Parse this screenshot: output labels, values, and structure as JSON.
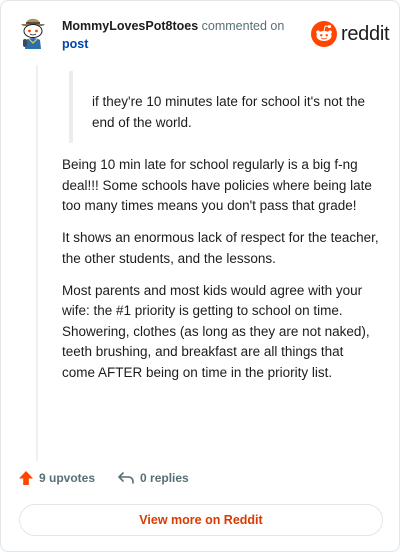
{
  "header": {
    "author": "MommyLovesPot8toes",
    "verb": "commented on",
    "target": "post"
  },
  "logo": {
    "word": "reddit",
    "icon": "reddit-snoo-icon",
    "color": "#ff4500"
  },
  "quote": {
    "text": "if they're 10 minutes late for school it's not the end of the world."
  },
  "comment": {
    "paragraphs": [
      "Being 10 min late for school regularly is a big f-ng deal!!! Some schools have policies where being late too many times means you don't pass that grade!",
      "It shows an enormous lack of respect for the teacher, the other students, and the lessons.",
      "Most parents and most kids would agree with your wife: the #1 priority is getting to school on time. Showering, clothes (as long as they are not naked), teeth brushing, and breakfast are all things that come AFTER being on time in the priority list."
    ]
  },
  "actions": {
    "upvotes": "9 upvotes",
    "upvote_icon": "upvote-arrow-icon",
    "upvote_color": "#ff4500",
    "replies": "0 replies",
    "reply_icon": "reply-arrow-icon"
  },
  "footer": {
    "view_more": "View more on Reddit",
    "accent": "#d93a00"
  }
}
